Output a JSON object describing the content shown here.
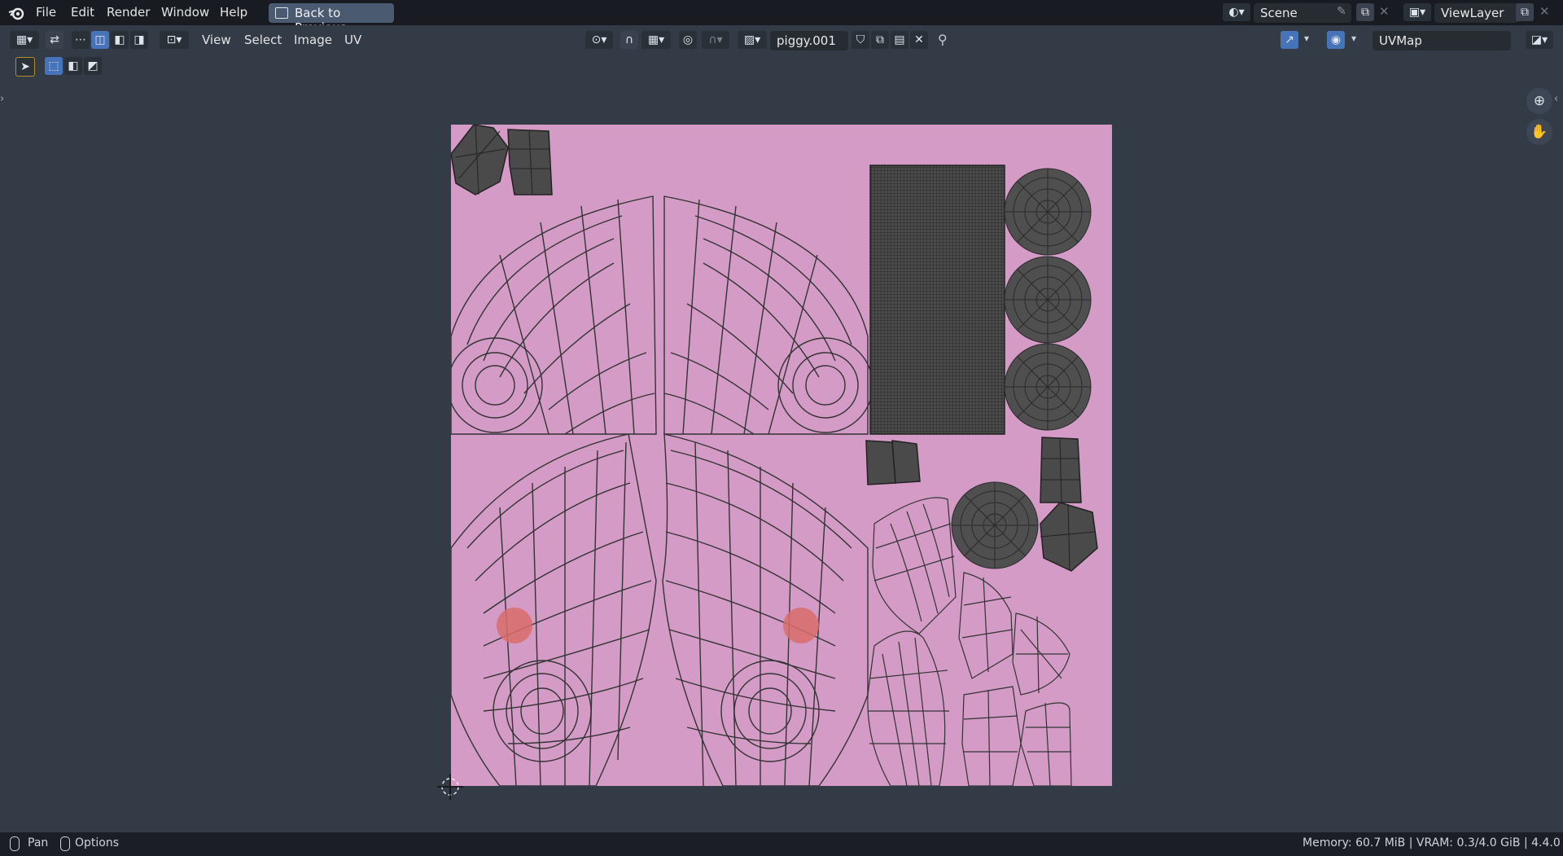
{
  "topbar": {
    "menus": [
      "File",
      "Edit",
      "Render",
      "Window",
      "Help"
    ],
    "back_button": "Back to Previous",
    "scene": "Scene",
    "view_layer": "ViewLayer"
  },
  "editor_header": {
    "menus": [
      "View",
      "Select",
      "Image",
      "UV"
    ],
    "image_name": "piggy.001",
    "uv_map": "UVMap"
  },
  "status": {
    "pan_label": "Pan",
    "options_label": "Options",
    "memory": "Memory: 60.7 MiB | VRAM: 0.3/4.0 GiB | 4.4.0"
  },
  "colors": {
    "texture_bg": "#d39bc6",
    "island_fill": "#4a4a4a",
    "accent": "#4773b8"
  }
}
